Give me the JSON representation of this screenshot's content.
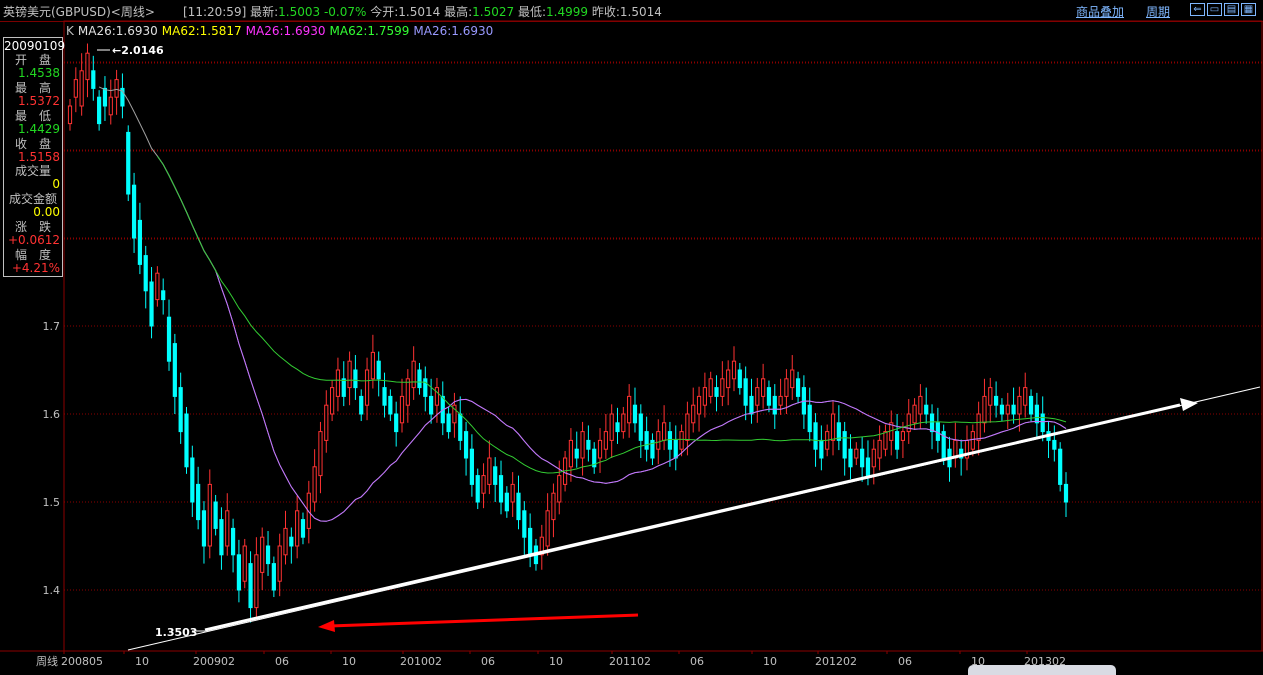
{
  "window": {
    "title": "英镑美元(GBPUSD)<周线>",
    "overlay_link": "商品叠加",
    "period_link": "周期"
  },
  "quote": {
    "time": "[11:20:59]",
    "latest_label": "最新:",
    "latest_value": "1.5003",
    "change": "-0.07%",
    "open_label": "今开:",
    "open_value": "1.5014",
    "high_label": "最高:",
    "high_value": "1.5027",
    "low_label": "最低:",
    "low_value": "1.4999",
    "prevclose_label": "昨收:",
    "prevclose_value": "1.5014"
  },
  "ma_legend": [
    {
      "label": "K",
      "color": "#c0c0c0"
    },
    {
      "label": "MA26:1.6930",
      "color": "#e0e0e0"
    },
    {
      "label": "MA62:1.5817",
      "color": "#ffff00"
    },
    {
      "label": "MA26:1.6930",
      "color": "#ff33ff"
    },
    {
      "label": "MA62:1.7599",
      "color": "#33ff33"
    },
    {
      "label": "MA26:1.6930",
      "color": "#9999ff"
    }
  ],
  "info": {
    "date": "20090109",
    "open_label": "开　盘",
    "open_value": "1.4538",
    "high_label": "最　高",
    "high_value": "1.5372",
    "low_label": "最　低",
    "low_value": "1.4429",
    "close_label": "收　盘",
    "close_value": "1.5158",
    "volume_label": "成交量",
    "volume_value": "0",
    "amount_label": "成交金额",
    "amount_value": "0.00",
    "change_label": "涨　跌",
    "change_value": "+0.0612",
    "range_label": "幅　度",
    "range_value": "+4.21%"
  },
  "chart_data": {
    "type": "candlestick",
    "y_ticks": [
      "1.7",
      "1.6",
      "1.5",
      "1.4"
    ],
    "x_ticks": [
      "200805",
      "10",
      "200902",
      "06",
      "10",
      "201002",
      "06",
      "10",
      "201102",
      "06",
      "10",
      "201202",
      "06",
      "10",
      "201302"
    ],
    "period_label": "周线",
    "ylim": [
      1.33,
      2.06
    ],
    "high_annotation": "2.0146",
    "low_annotation": "1.3503",
    "colors": {
      "up": "#ff3232",
      "down": "#00ffff",
      "ma_gray": "#a0a0a0",
      "ma_purple": "#c070ff",
      "ma_green": "#33cc33",
      "trendline": "#ffffff",
      "arrow": "#ff0000",
      "grid": "#8b0000"
    }
  }
}
